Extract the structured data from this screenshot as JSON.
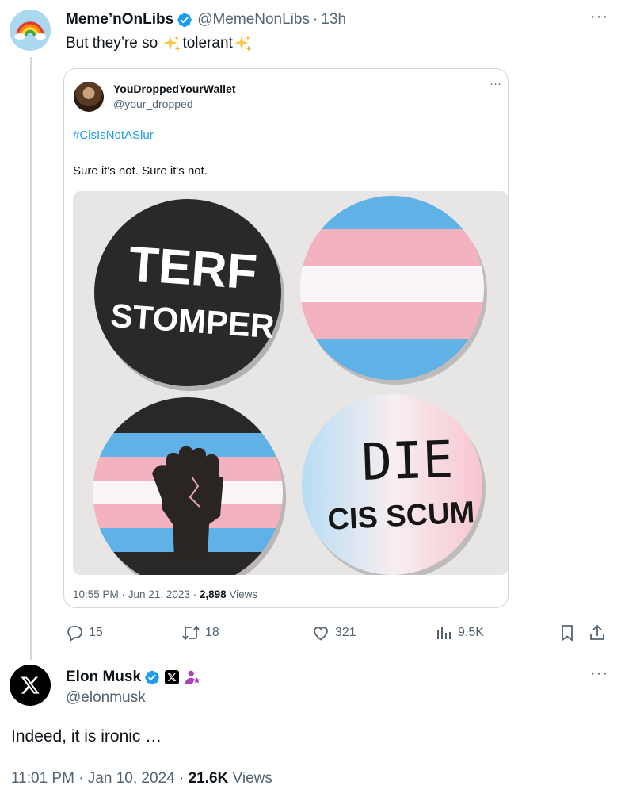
{
  "parent": {
    "name": "Meme’nOnLibs",
    "handle": "@MemeNonLibs",
    "separator": "·",
    "time": "13h",
    "more": "···",
    "text_before": "But they’re so ",
    "text_word": "tolerant",
    "quote": {
      "name": "YouDroppedYourWallet",
      "handle": "@your_dropped",
      "more": "···",
      "hashtag": "#CisIsNotASlur",
      "text": "Sure it's not. Sure it's not.",
      "image": {
        "button1_line1": "TERF",
        "button1_line2": "STOMPER",
        "button4_line1": "DIE",
        "button4_line2": "CIS SCUM"
      },
      "meta_time": "10:55 PM · Jun 21, 2023 · ",
      "meta_views_count": "2,898",
      "meta_views_label": " Views"
    },
    "actions": {
      "replies": "15",
      "reposts": "18",
      "likes": "321",
      "views": "9.5K"
    }
  },
  "reply": {
    "name": "Elon Musk",
    "handle": "@elonmusk",
    "more": "···",
    "text": "Indeed, it is ironic …",
    "meta_time": "11:01 PM · Jan 10, 2024 · ",
    "meta_views_count": "21.6K",
    "meta_views_label": " Views"
  },
  "colors": {
    "verified": "#1d9bf0",
    "muted_text": "#536471",
    "link": "#1d9bf0",
    "trans_blue": "#5bcefa",
    "trans_pink": "#f5a9b8",
    "sparkle": "#f7c948"
  },
  "icons": [
    "rainbow-avatar",
    "verified-badge-icon",
    "sparkles-icon",
    "reply-icon",
    "repost-icon",
    "like-icon",
    "views-icon",
    "bookmark-icon",
    "share-icon",
    "x-logo-icon",
    "affiliate-person-icon"
  ]
}
